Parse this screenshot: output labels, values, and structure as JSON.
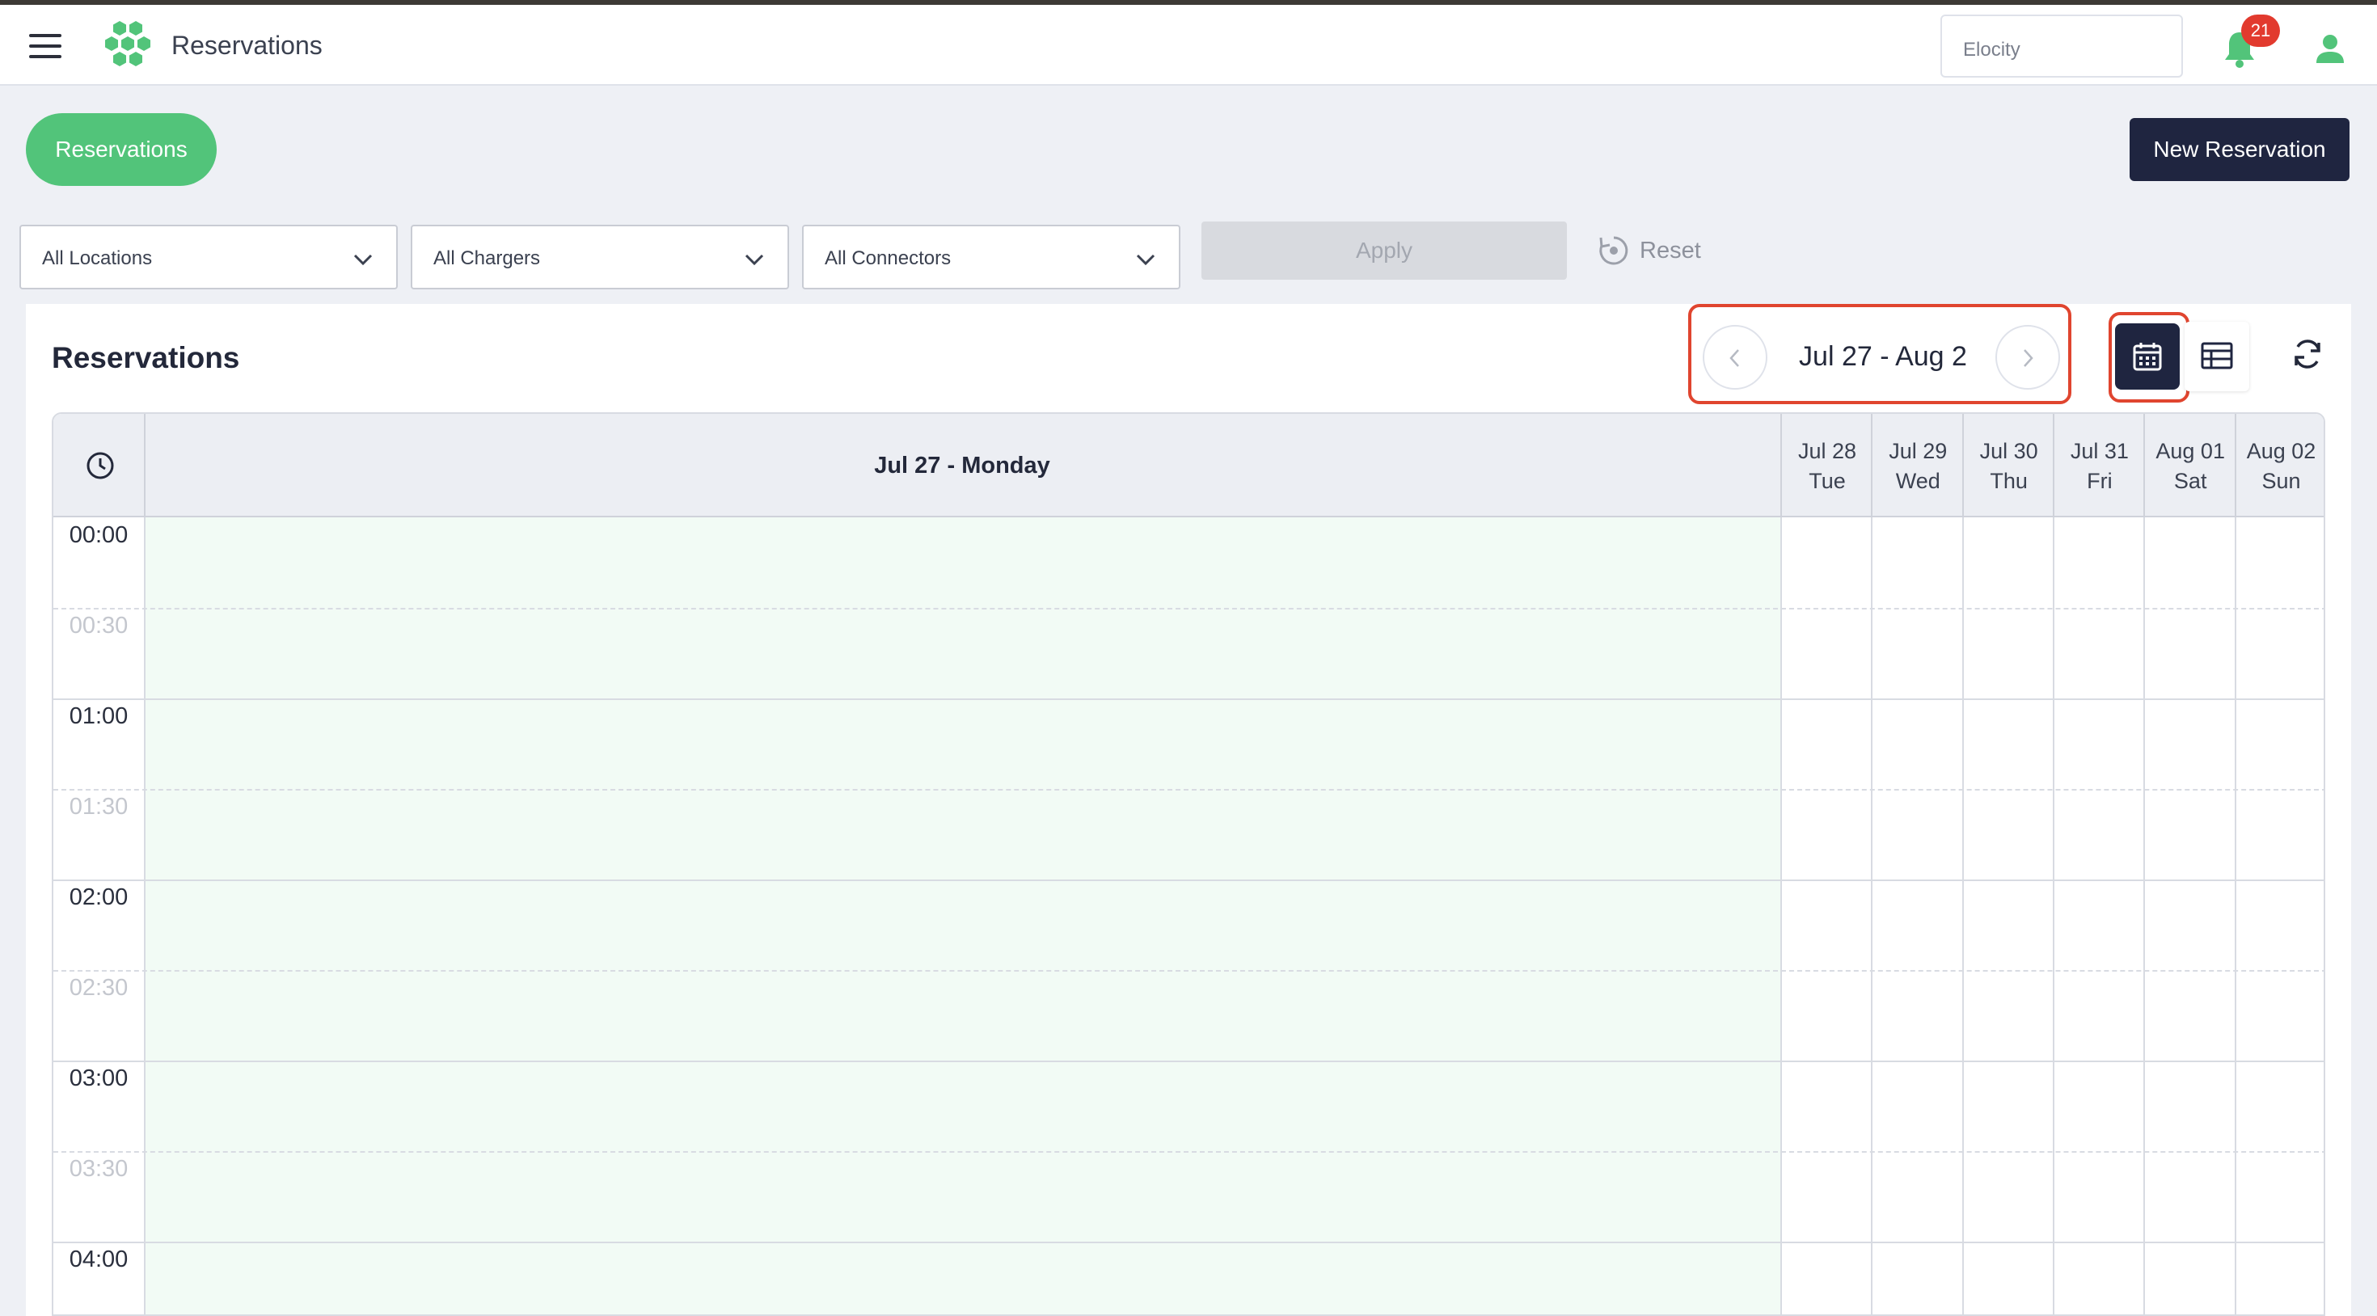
{
  "header": {
    "app_title": "Reservations",
    "org_select": "Elocity",
    "notification_count": "21",
    "brand_color": "#52c47a"
  },
  "toolbar": {
    "tab_label": "Reservations",
    "new_reservation_label": "New Reservation"
  },
  "filters": {
    "locations": "All Locations",
    "chargers": "All Chargers",
    "connectors": "All Connectors",
    "apply_label": "Apply",
    "reset_label": "Reset"
  },
  "calendar": {
    "title": "Reservations",
    "range": "Jul 27 - Aug 2",
    "selected_day": "Jul 27 - Monday",
    "days": [
      {
        "date": "Jul 28",
        "weekday": "Tue"
      },
      {
        "date": "Jul 29",
        "weekday": "Wed"
      },
      {
        "date": "Jul 30",
        "weekday": "Thu"
      },
      {
        "date": "Jul 31",
        "weekday": "Fri"
      },
      {
        "date": "Aug 01",
        "weekday": "Sat"
      },
      {
        "date": "Aug 02",
        "weekday": "Sun"
      }
    ],
    "times": [
      "00:00",
      "00:30",
      "01:00",
      "01:30",
      "02:00",
      "02:30",
      "03:00",
      "03:30",
      "04:00"
    ]
  },
  "icons": {
    "menu": "menu-icon",
    "logo": "hexagon-cluster-logo",
    "notifications": "bell-icon",
    "user": "user-icon",
    "calendar_view": "calendar-icon",
    "table_view": "table-icon",
    "refresh": "refresh-icon",
    "reset": "reset-icon",
    "clock": "clock-icon"
  }
}
